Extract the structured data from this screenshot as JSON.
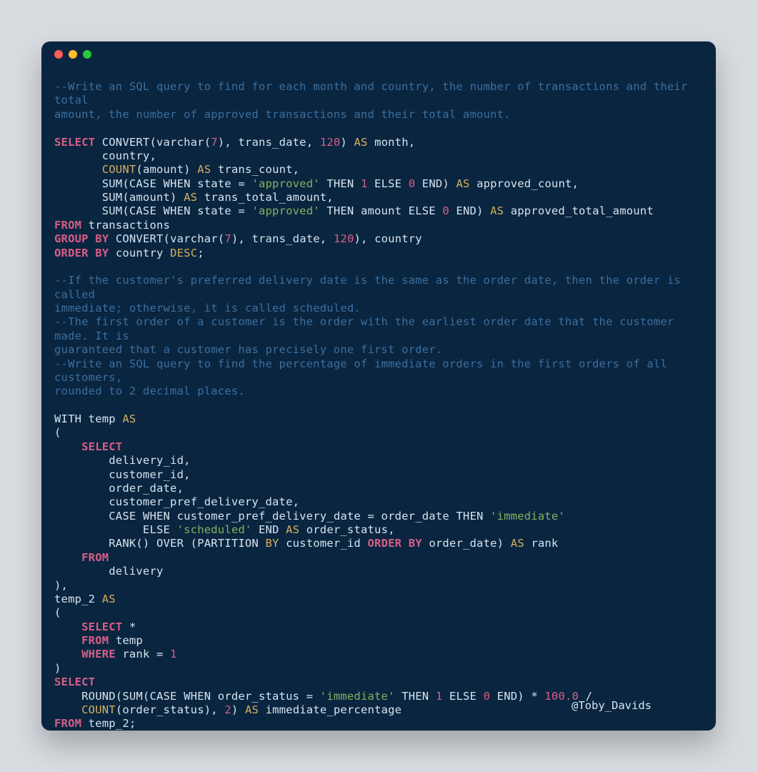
{
  "window": {
    "attribution": "@Toby_Davids"
  },
  "code": {
    "comment1_a": "--Write an SQL query to find for each month and country, the number of transactions and their total",
    "comment1_b": "amount, the number of approved transactions and their total amount.",
    "q1_l1_select": "SELECT",
    "q1_l1_rest_a": " CONVERT(varchar(",
    "q1_l1_num7": "7",
    "q1_l1_rest_b": "), trans_date, ",
    "q1_l1_num120": "120",
    "q1_l1_rest_c": ") ",
    "q1_l1_as": "AS",
    "q1_l1_rest_d": " month,",
    "q1_l2": "       country,",
    "q1_l3_indent": "       ",
    "q1_l3_count": "COUNT",
    "q1_l3_rest_a": "(amount) ",
    "q1_l3_as": "AS",
    "q1_l3_rest_b": " trans_count,",
    "q1_l4_indent": "       SUM(CASE WHEN state = ",
    "q1_l4_str": "'approved'",
    "q1_l4_then": " THEN ",
    "q1_l4_num1": "1",
    "q1_l4_else": " ELSE ",
    "q1_l4_num0": "0",
    "q1_l4_end": " END) ",
    "q1_l4_as": "AS",
    "q1_l4_tail": " approved_count,",
    "q1_l5_indent": "       SUM(amount) ",
    "q1_l5_as": "AS",
    "q1_l5_tail": " trans_total_amount,",
    "q1_l6_indent": "       SUM(CASE WHEN state = ",
    "q1_l6_str": "'approved'",
    "q1_l6_then": " THEN amount ELSE ",
    "q1_l6_num0": "0",
    "q1_l6_end": " END) ",
    "q1_l6_as": "AS",
    "q1_l6_tail": " approved_total_amount",
    "q1_from": "FROM",
    "q1_from_tail": " transactions",
    "q1_group": "GROUP",
    "q1_by1": "BY",
    "q1_group_tail_a": " CONVERT(varchar(",
    "q1_group_num7": "7",
    "q1_group_tail_b": "), trans_date, ",
    "q1_group_num120": "120",
    "q1_group_tail_c": "), country",
    "q1_order": "ORDER",
    "q1_by2": "BY",
    "q1_order_mid": " country ",
    "q1_desc": "DESC",
    "q1_semi": ";",
    "comment2_a": "--If the customer's preferred delivery date is the same as the order date, then the order is called",
    "comment2_b": "immediate; otherwise, it is called scheduled.",
    "comment2_c": "--The first order of a customer is the order with the earliest order date that the customer made. It is",
    "comment2_d": "guaranteed that a customer has precisely one first order.",
    "comment2_e": "--Write an SQL query to find the percentage of immediate orders in the first orders of all customers,",
    "comment2_f": "rounded to 2 decimal places.",
    "q2_with": "WITH temp ",
    "q2_as1": "AS",
    "q2_open1": "(",
    "q2_select1": "    SELECT",
    "q2_col1": "        delivery_id,",
    "q2_col2": "        customer_id,",
    "q2_col3": "        order_date,",
    "q2_col4": "        customer_pref_delivery_date,",
    "q2_case_a": "        CASE WHEN customer_pref_delivery_date = order_date THEN ",
    "q2_str_imm": "'immediate'",
    "q2_case_else": "             ELSE ",
    "q2_str_sch": "'scheduled'",
    "q2_case_end": " END ",
    "q2_as2": "AS",
    "q2_case_tail": " order_status,",
    "q2_rank_a": "        RANK() OVER (PARTITION ",
    "q2_by3": "BY",
    "q2_rank_mid": " customer_id ",
    "q2_order2": "ORDER",
    "q2_by4": "BY",
    "q2_rank_tail": " order_date) ",
    "q2_as3": "AS",
    "q2_rank_col": " rank",
    "q2_from2": "    FROM",
    "q2_del": "        delivery",
    "q2_close1": "),",
    "q2_temp2": "temp_2 ",
    "q2_as4": "AS",
    "q2_open2": "(",
    "q2_select2": "    SELECT",
    "q2_star": " *",
    "q2_from3": "    FROM",
    "q2_from3_tail": " temp",
    "q2_where": "    WHERE",
    "q2_where_tail": " rank = ",
    "q2_num1b": "1",
    "q2_close2": ")",
    "q2_select3": "SELECT",
    "q2_round_a": "    ROUND(SUM(CASE WHEN order_status = ",
    "q2_str_imm2": "'immediate'",
    "q2_round_then": " THEN ",
    "q2_num1c": "1",
    "q2_round_else": " ELSE ",
    "q2_num0b": "0",
    "q2_round_end": " END) * ",
    "q2_num100": "100.0",
    "q2_round_slash": " /",
    "q2_count_line_indent": "    ",
    "q2_count2": "COUNT",
    "q2_count_tail_a": "(order_status), ",
    "q2_num2": "2",
    "q2_count_tail_b": ") ",
    "q2_as5": "AS",
    "q2_count_tail_c": " immediate_percentage",
    "q2_from4": "FROM",
    "q2_from4_tail": " temp_2;"
  }
}
